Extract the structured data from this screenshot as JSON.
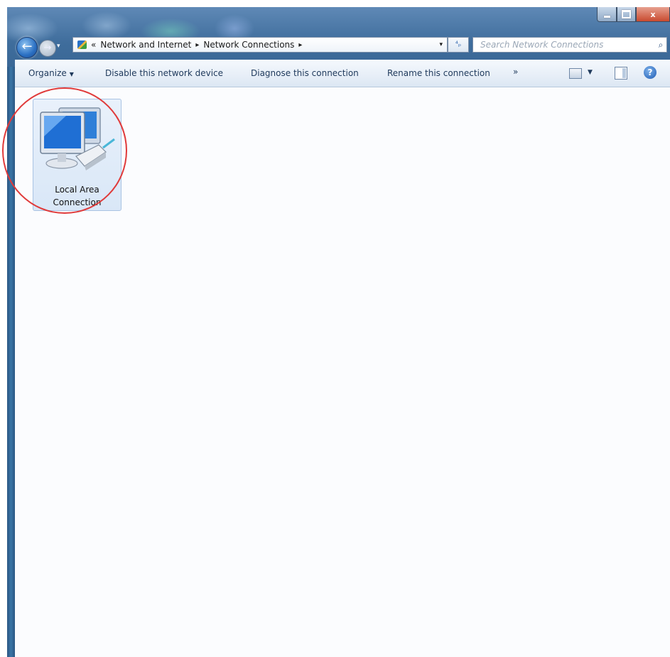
{
  "window": {
    "caption_buttons": {
      "minimize": "",
      "maximize": "",
      "close": "x"
    }
  },
  "address_bar": {
    "prefix": "«",
    "crumbs": [
      "Network and Internet",
      "Network Connections"
    ],
    "separator": "▸",
    "dropdown_glyph": "▾",
    "refresh_glyph": "⁴ₚ"
  },
  "search": {
    "placeholder": "Search Network Connections",
    "icon": "search-icon"
  },
  "toolbar": {
    "organize": "Organize",
    "disable": "Disable this network device",
    "diagnose": "Diagnose this connection",
    "rename": "Rename this connection",
    "more": "»",
    "help": "?"
  },
  "items": [
    {
      "label_line1": "Local Area",
      "label_line2": "Connection",
      "icon": "network-adapter-icon",
      "selected": true
    }
  ],
  "annotation": {
    "color": "#e03a3a"
  }
}
